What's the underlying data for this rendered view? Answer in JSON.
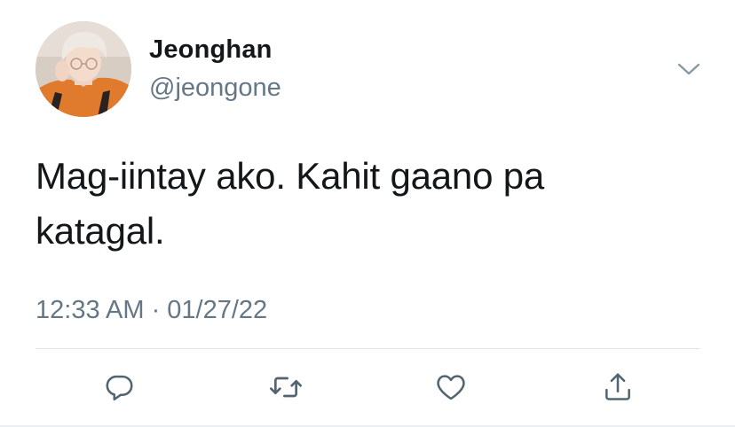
{
  "tweet": {
    "author_name": "Jeonghan",
    "author_handle": "@jeongone",
    "text_line1": "Mag-iintay ako. Kahit gaano pa",
    "text_line2": "katagal.",
    "timestamp": "12:33 AM · 01/27/22"
  },
  "icons": {
    "menu": "chevron-down-icon",
    "reply": "reply-icon",
    "retweet": "retweet-icon",
    "like": "heart-icon",
    "share": "share-icon"
  },
  "colors": {
    "text": "#14171a",
    "secondary": "#657786",
    "divider": "#dfe3e6"
  }
}
